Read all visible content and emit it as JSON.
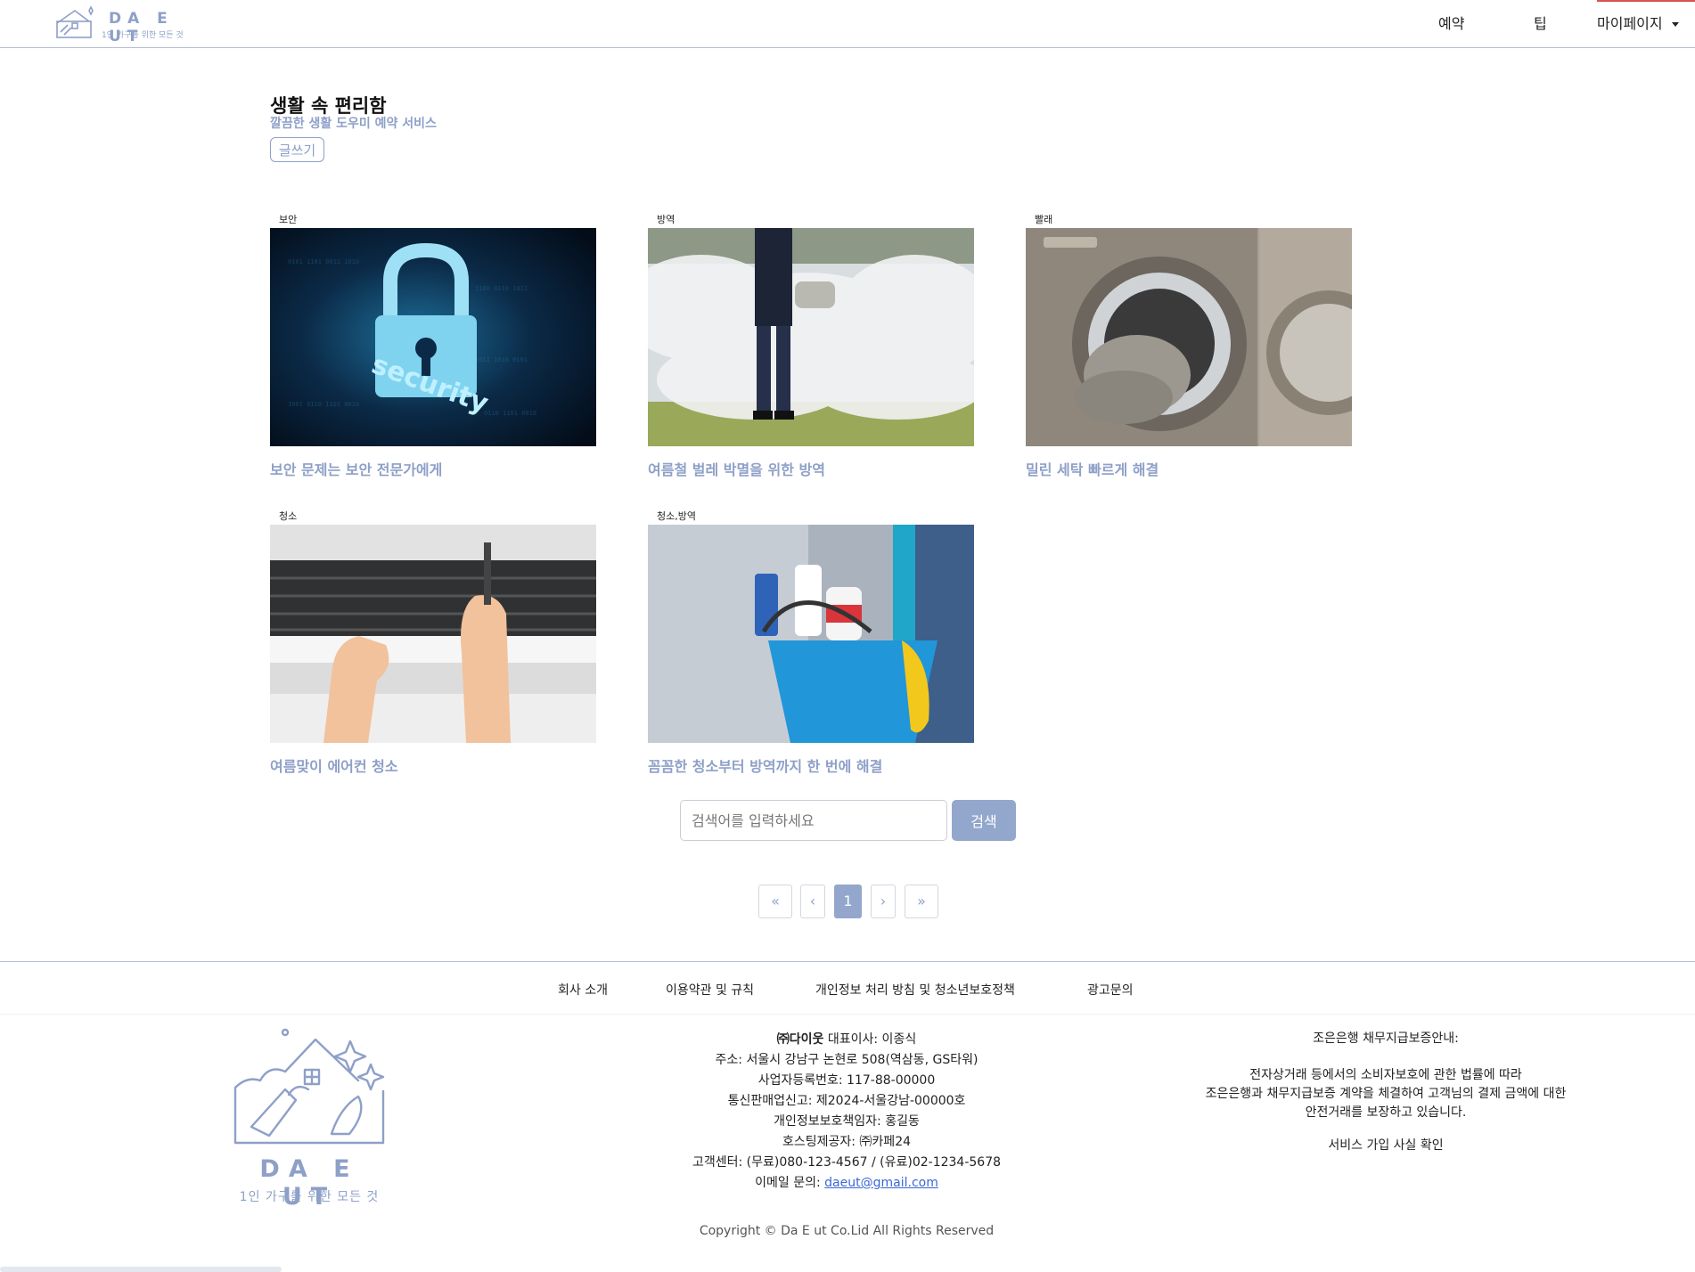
{
  "header": {
    "logo_name": "DA E UT",
    "logo_tagline": "1인 가구를 위한 모든 것",
    "nav": [
      {
        "label": "예약"
      },
      {
        "label": "팁"
      },
      {
        "label": "마이페이지"
      }
    ]
  },
  "intro": {
    "title": "생활 속 편리함",
    "subtitle": "깔끔한 생활 도우미 예약 서비스",
    "write_button": "글쓰기"
  },
  "cards": [
    {
      "category": "보안",
      "title": "보안 문제는 보안 전문가에게",
      "image": "security-lock-image"
    },
    {
      "category": "방역",
      "title": "여름철 벌레 박멸을 위한 방역",
      "image": "pest-fogging-image"
    },
    {
      "category": "빨래",
      "title": "밀린 세탁 빠르게 해결",
      "image": "washing-machine-image"
    },
    {
      "category": "청소",
      "title": "여름맞이 에어컨 청소",
      "image": "aircon-cleaning-image"
    },
    {
      "category": "청소,방역",
      "title": "꼼꼼한 청소부터 방역까지 한 번에 해결",
      "image": "cleaning-bucket-image"
    }
  ],
  "search": {
    "placeholder": "검색어를 입력하세요",
    "button": "검색"
  },
  "pagination": {
    "first": "«",
    "prev": "‹",
    "current": "1",
    "next": "›",
    "last": "»"
  },
  "footer": {
    "links": [
      "회사 소개",
      "이용약관 및 규칙",
      "개인정보 처리 방침 및 청소년보호정책",
      "광고문의"
    ],
    "logo_name": "DA E UT",
    "logo_tagline": "1인 가구를 위한 모든 것",
    "company": {
      "name": "㈜다이웃",
      "ceo": " 대표이사: 이종식",
      "address": "주소: 서울시 강남구 논현로 508(역삼동, GS타워)",
      "biz_no": "사업자등록번호: 117-88-00000",
      "ecommerce": "통신판매업신고: 제2024-서울강남-00000호",
      "privacy_officer": "개인정보보호책임자: 홍길동",
      "hosting": "호스팅제공자: ㈜카페24",
      "call_center": "고객센터: (무료)080-123-4567 / (유료)02-1234-5678",
      "email_label": "이메일 문의: ",
      "email": "daeut@gmail.com"
    },
    "guarantee": {
      "title": "조은은행 채무지급보증안내:",
      "lines": [
        "전자상거래 등에서의 소비자보호에 관한 법률에 따라",
        "조은은행과 채무지급보증 계약을 체결하여 고객님의 결제 금액에 대한",
        "안전거래를 보장하고 있습니다."
      ],
      "confirm": "서비스 가입 사실 확인"
    },
    "copyright": "Copyright © Da E ut Co.Lid All Rights Reserved"
  },
  "colors": {
    "accent": "#8ea0c8",
    "button": "#93a6cc",
    "link": "#3b66d6"
  }
}
